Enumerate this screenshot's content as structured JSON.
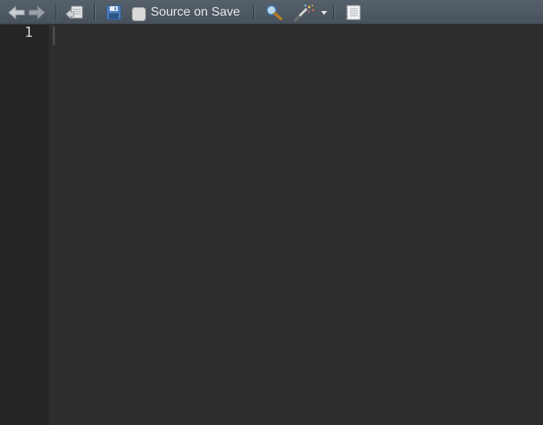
{
  "toolbar": {
    "icons": {
      "back": "arrow-left-icon",
      "forward": "arrow-right-icon",
      "show_in_window": "show-in-window-icon",
      "save": "floppy-disk-icon",
      "search": "magnifier-icon",
      "code_tools": "magic-wand-icon",
      "dropdown": "caret-down-icon",
      "compile_report": "notebook-icon"
    },
    "source_on_save": {
      "label": "Source on Save",
      "checked": false
    }
  },
  "editor": {
    "line_numbers": [
      "1"
    ],
    "content": ""
  },
  "colors": {
    "toolbar_bg": "#4f5963",
    "editor_bg": "#2d2d2d",
    "gutter_bg": "#252525",
    "line_number": "#d0d0d0"
  }
}
